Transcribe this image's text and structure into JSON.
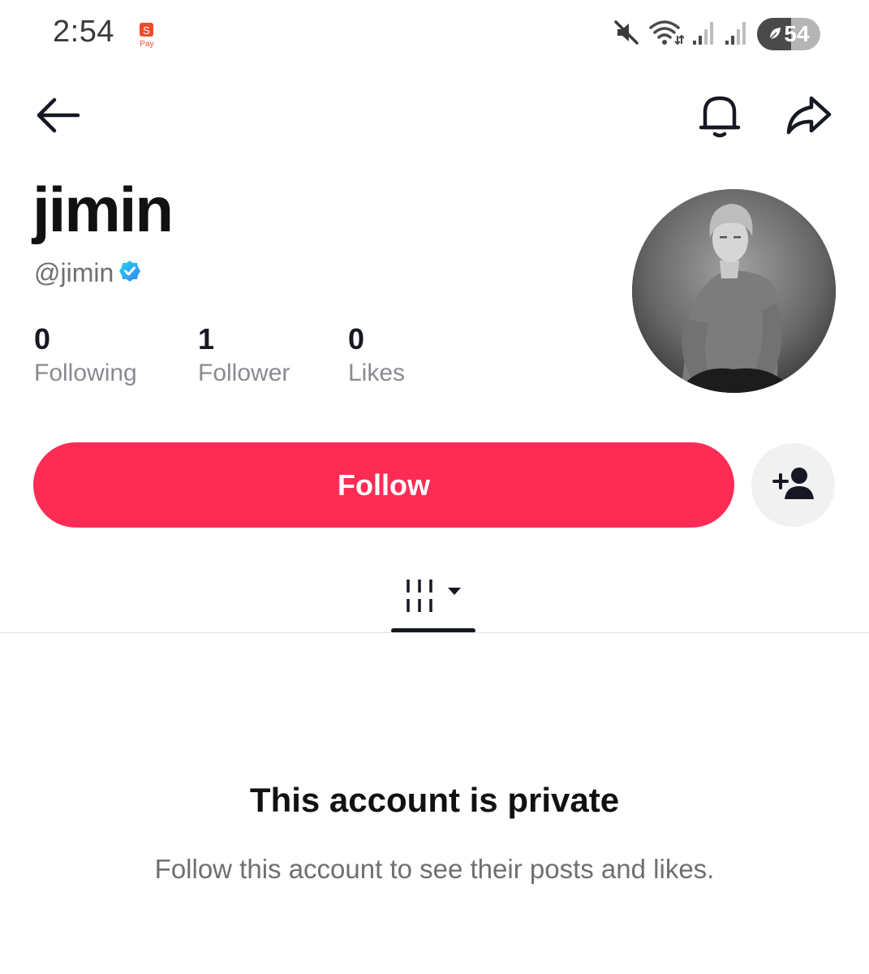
{
  "status_bar": {
    "time": "2:54",
    "notification_app": "S Pay",
    "notification_app_badge": "S",
    "notification_app_caption": "Pay",
    "icons": [
      "mute-icon",
      "wifi-icon",
      "signal-icon",
      "signal-icon"
    ],
    "battery_level": "54",
    "battery_fraction": 0.54
  },
  "nav": {
    "back_icon": "arrow-left-icon",
    "bell_icon": "bell-icon",
    "share_icon": "share-icon"
  },
  "profile": {
    "display_name": "jimin",
    "handle": "@jimin",
    "verified": true,
    "avatar": "profile photo (black and white portrait)"
  },
  "stats": [
    {
      "value": "0",
      "label": "Following"
    },
    {
      "value": "1",
      "label": "Follower"
    },
    {
      "value": "0",
      "label": "Likes"
    }
  ],
  "actions": {
    "follow_label": "Follow",
    "suggest_icon": "add-user-icon"
  },
  "tabs": {
    "videos_icon": "grid-lines-icon",
    "dropdown_icon": "caret-down-icon"
  },
  "private_notice": {
    "title": "This account is private",
    "subtitle": "Follow this account to see their posts and likes."
  },
  "colors": {
    "accent": "#fe2c55",
    "verified": "#20d5ec",
    "text_primary": "#161823",
    "text_secondary": "#8a8b91"
  }
}
